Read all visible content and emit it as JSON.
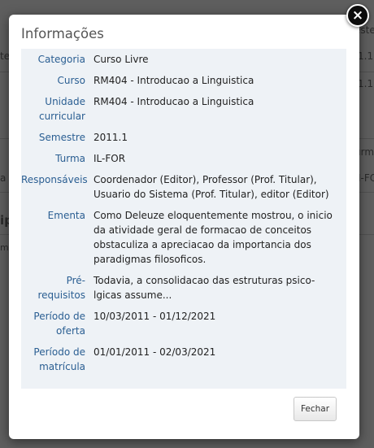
{
  "background": {
    "fragments": [
      "este",
      "te",
      "1.1",
      "1.1",
      "a",
      "I-FO",
      "ip",
      "mi",
      "urma"
    ]
  },
  "modal": {
    "title": "Informações",
    "close_label": "×",
    "fields": [
      {
        "label": "Categoria",
        "value": "Curso Livre"
      },
      {
        "label": "Curso",
        "value": "RM404 - Introducao a Linguistica"
      },
      {
        "label": "Unidade curricular",
        "value": "RM404 - Introducao a Linguistica"
      },
      {
        "label": "Semestre",
        "value": "2011.1"
      },
      {
        "label": "Turma",
        "value": "IL-FOR"
      },
      {
        "label": "Responsáveis",
        "value": "Coordenador (Editor), Professor (Prof. Titular), Usuario do Sistema (Prof. Titular), editor (Editor)"
      },
      {
        "label": "Ementa",
        "value": "Como Deleuze eloquentemente mostrou, o inicio da atividade geral de formacao de conceitos obstaculiza a apreciacao da importancia dos paradigmas filosoficos."
      },
      {
        "label": "Pré-requisitos",
        "value": "Todavia, a consolidacao das estruturas psico-lgicas assume..."
      },
      {
        "label": "Período de oferta",
        "value": "10/03/2011 - 01/12/2021"
      },
      {
        "label": "Período de matrícula",
        "value": "01/01/2011 - 02/03/2021"
      }
    ],
    "close_button_label": "Fechar"
  }
}
